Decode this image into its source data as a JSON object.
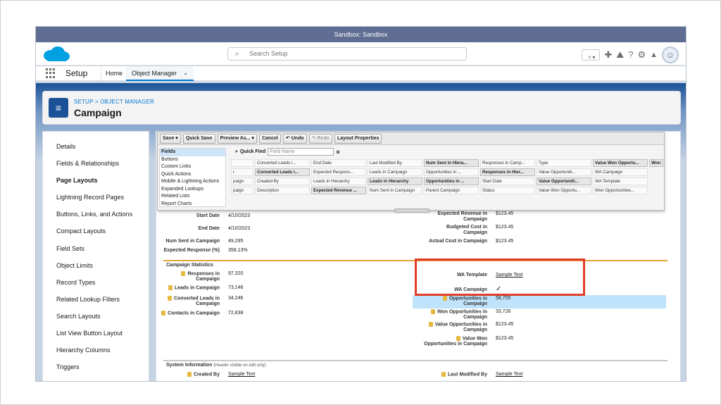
{
  "sandbox_label": "Sandbox: Sandbox",
  "header": {
    "search_placeholder": "Search Setup",
    "fav_star": "★",
    "fav_chev": "▾",
    "icons": [
      "add-icon",
      "trailhead-icon",
      "help-icon",
      "gear-icon",
      "bell-icon",
      "avatar"
    ],
    "add": "✚",
    "trailhead": "⛰",
    "help": "?",
    "gear": "⚙",
    "bell": "🔔",
    "avatar": "☺"
  },
  "nav": {
    "app_name": "Setup",
    "home": "Home",
    "object_manager": "Object Manager",
    "chevron": "⌄"
  },
  "page_header": {
    "breadcrumb": "SETUP > OBJECT MANAGER",
    "title": "Campaign"
  },
  "sidebar": {
    "items": [
      "Details",
      "Fields & Relationships",
      "Page Layouts",
      "Lightning Record Pages",
      "Buttons, Links, and Actions",
      "Compact Layouts",
      "Field Sets",
      "Object Limits",
      "Record Types",
      "Related Lookup Filters",
      "Search Layouts",
      "List View Button Layout",
      "Hierarchy Columns",
      "Triggers"
    ],
    "active": "Page Layouts"
  },
  "palette": {
    "toolbar": {
      "save": "Save ▾",
      "quick_save": "Quick Save",
      "preview": "Preview As... ▾",
      "cancel": "Cancel",
      "undo": "↶ Undo",
      "redo": "↷ Redo",
      "layout_properties": "Layout Properties"
    },
    "categories": [
      "Fields",
      "Buttons",
      "Custom Links",
      "Quick Actions",
      "Mobile & Lightning Actions",
      "Expanded Lookups",
      "Related Lists",
      "Report Charts"
    ],
    "quick_find_label": "Quick Find",
    "quick_find_placeholder": "Field Name",
    "clear": "⊗",
    "rows": [
      [
        "",
        "Converted Leads i...",
        "End Date",
        "Last Modified By",
        "Num Sent in Hiera...",
        "Responses in Camp...",
        "Type",
        "Value Won Opportu...",
        "Won"
      ],
      [
        "r",
        "Converted Leads i...",
        "Expected Respons...",
        "Leads in Campaign",
        "Opportunities in ...",
        "Responses in Hier...",
        "Value Opportuniti...",
        "WA Campaign",
        ""
      ],
      [
        "paign",
        "Created By",
        "Leads in Hierarchy",
        "Leads in Hierarchy",
        "Opportunities in ...",
        "Start Date",
        "Value Opportuniti...",
        "WA Template",
        ""
      ],
      [
        "paign",
        "Description",
        "Expected Revenue ...",
        "Num Sent in Campaign",
        "Parent Campaign",
        "Status",
        "Value Won Opportu...",
        "Won Opportunities...",
        ""
      ]
    ]
  },
  "detail": {
    "left_top": [
      {
        "label": "Start Date",
        "value": "4/10/2023"
      },
      {
        "label": "End Date",
        "value": "4/10/2023"
      },
      {
        "label": "Num Sent in Campaign",
        "value": "49,295"
      },
      {
        "label": "Expected Response (%)",
        "value": "358.13%"
      }
    ],
    "right_top": [
      {
        "label": "Expected Revenue in Campaign",
        "value": "$123.45"
      },
      {
        "label": "Budgeted Cost in Campaign",
        "value": "$123.45"
      },
      {
        "label": "Actual Cost in Campaign",
        "value": "$123.45"
      }
    ],
    "section_stats": "Campaign Statistics",
    "left_stats": [
      {
        "label": "Responses in Campaign",
        "value": "97,320"
      },
      {
        "label": "Leads in Campaign",
        "value": "73,146"
      },
      {
        "label": "Converted Leads in Campaign",
        "value": "34,246"
      },
      {
        "label": "Contacts in Campaign",
        "value": "72,838"
      }
    ],
    "right_stats": [
      {
        "label": "WA Template",
        "value": "Sample Text"
      },
      {
        "label": "WA Campaign",
        "value": "✓"
      },
      {
        "label": "Opportunities in Campaign",
        "value": "58,755"
      },
      {
        "label": "Won Opportunities in Campaign",
        "value": "33,726"
      },
      {
        "label": "Value Opportunities in Campaign",
        "value": "$123.45"
      },
      {
        "label": "Value Won Opportunities in Campaign",
        "value": "$123.45"
      }
    ],
    "section_system": "System Information",
    "section_system_sub": "(Header visible on edit only)",
    "created_by_label": "Created By",
    "created_by_value": "Sample Text",
    "last_modified_label": "Last Modified By",
    "last_modified_value": "Sample Text"
  },
  "colors": {
    "sandbox_bar": "#5e6d91",
    "brand_blue": "#0176d3",
    "callout": "#e23d28",
    "section_accent": "#e6a33a"
  }
}
